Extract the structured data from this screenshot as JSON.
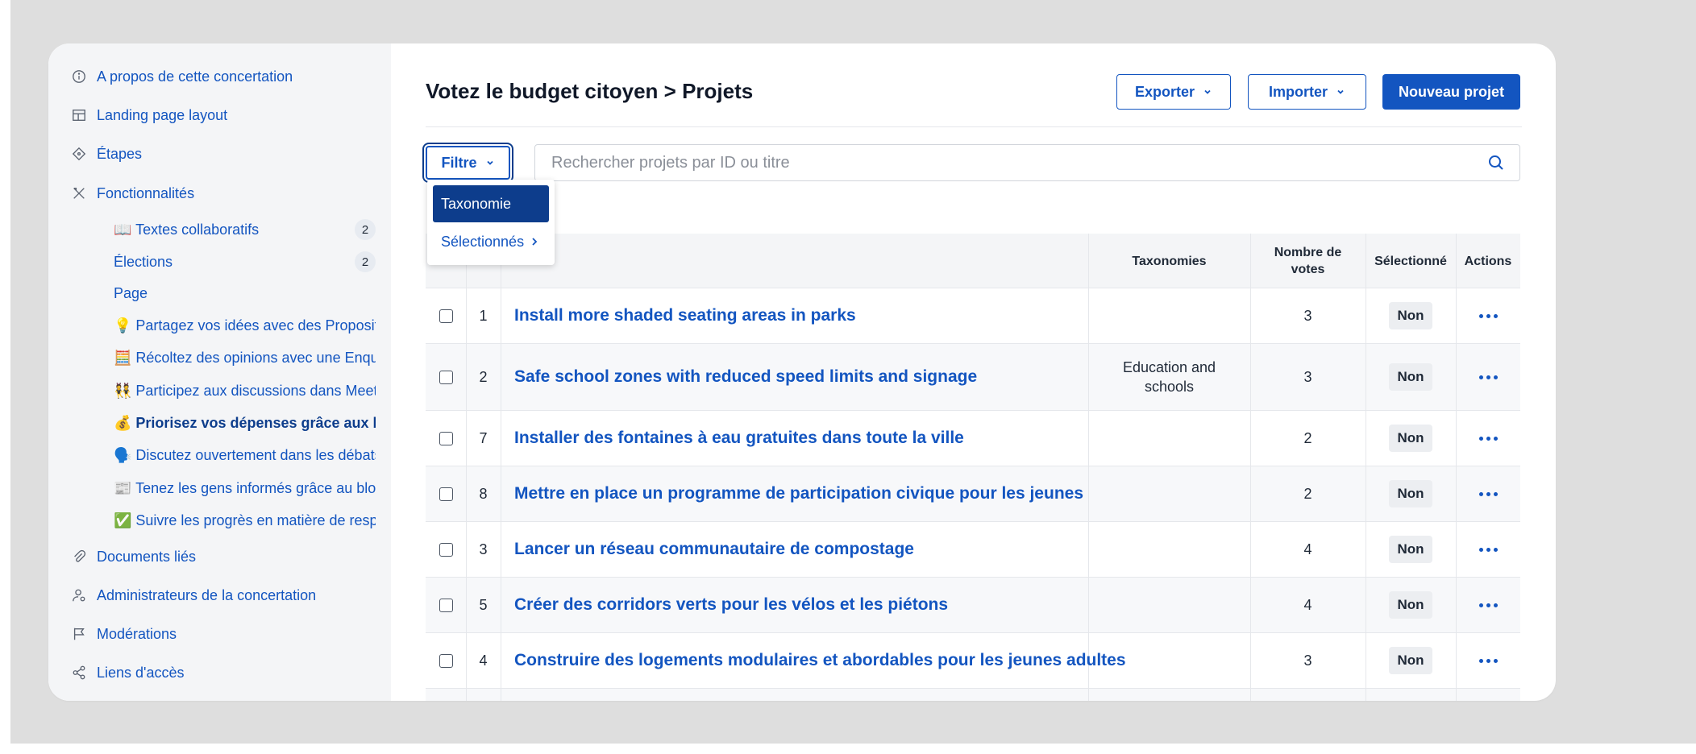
{
  "sidebar": {
    "items": [
      {
        "label": "A propos de cette concertation",
        "icon": "info-icon"
      },
      {
        "label": "Landing page layout",
        "icon": "layout-icon"
      },
      {
        "label": "Étapes",
        "icon": "diamond-icon"
      },
      {
        "label": "Fonctionnalités",
        "icon": "tools-icon"
      }
    ],
    "sub_items": [
      {
        "label": "📖 Textes collaboratifs",
        "count": "2"
      },
      {
        "label": "Élections",
        "count": "2"
      },
      {
        "label": "Page",
        "count": ""
      },
      {
        "label": "💡 Partagez vos idées avec des Propositic",
        "count": ""
      },
      {
        "label": "🧮 Récoltez des opinions avec une Enquê",
        "count": ""
      },
      {
        "label": "👯 Participez aux discussions dans Meetir",
        "count": ""
      },
      {
        "label": "💰 Priorisez vos dépenses grâce aux bud",
        "count": ""
      },
      {
        "label": "🗣️ Discutez ouvertement dans les débats",
        "count": ""
      },
      {
        "label": "📰 Tenez les gens informés grâce au blog",
        "count": ""
      },
      {
        "label": "✅ Suivre les progrès en matière de respo",
        "count": ""
      }
    ],
    "bottom_items": [
      {
        "label": "Documents liés",
        "icon": "paperclip-icon"
      },
      {
        "label": "Administrateurs de la concertation",
        "icon": "user-settings-icon"
      },
      {
        "label": "Modérations",
        "icon": "flag-icon"
      },
      {
        "label": "Liens d'accès",
        "icon": "share-icon"
      }
    ]
  },
  "header": {
    "title": "Votez le budget citoyen > Projets",
    "export_label": "Exporter",
    "import_label": "Importer",
    "new_label": "Nouveau projet"
  },
  "filter": {
    "label": "Filtre",
    "menu": {
      "active": "Taxonomie",
      "other": "Sélectionnés"
    }
  },
  "search": {
    "placeholder": "Rechercher projets par ID ou titre",
    "value": ""
  },
  "table": {
    "headers": {
      "taxonomies": "Taxonomies",
      "votes": "Nombre de votes",
      "selected": "Sélectionné",
      "actions": "Actions"
    },
    "rows": [
      {
        "id": "1",
        "title": "Install more shaded seating areas in parks",
        "taxonomy": "",
        "votes": "3",
        "selected": "Non"
      },
      {
        "id": "2",
        "title": "Safe school zones with reduced speed limits and signage",
        "taxonomy": "Education and schools",
        "votes": "3",
        "selected": "Non"
      },
      {
        "id": "7",
        "title": "Installer des fontaines à eau gratuites dans toute la ville",
        "taxonomy": "",
        "votes": "2",
        "selected": "Non"
      },
      {
        "id": "8",
        "title": "Mettre en place un programme de participation civique pour les jeunes",
        "taxonomy": "",
        "votes": "2",
        "selected": "Non"
      },
      {
        "id": "3",
        "title": "Lancer un réseau communautaire de compostage",
        "taxonomy": "",
        "votes": "4",
        "selected": "Non"
      },
      {
        "id": "5",
        "title": "Créer des corridors verts pour les vélos et les piétons",
        "taxonomy": "",
        "votes": "4",
        "selected": "Non"
      },
      {
        "id": "4",
        "title": "Construire des logements modulaires et abordables pour les jeunes adultes",
        "taxonomy": "",
        "votes": "3",
        "selected": "Non"
      }
    ]
  }
}
